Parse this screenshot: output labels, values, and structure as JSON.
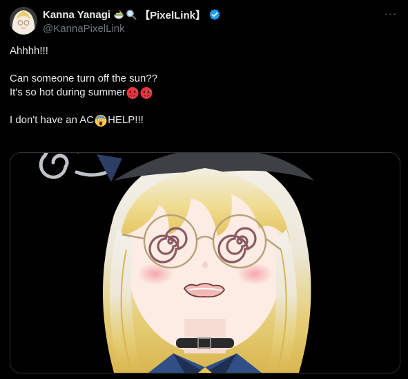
{
  "author": {
    "display_name": "Kanna Yanagi",
    "name_emoji": [
      "noodle-bowl-emoji",
      "magnifier-emoji"
    ],
    "affiliation": "【PixelLink】",
    "handle": "@KannaPixelLink",
    "verified": true,
    "verified_color": "#1d9bf0"
  },
  "menu": {
    "more_label": "···"
  },
  "post": {
    "line1": "Ahhhh!!!",
    "line2": "Can someone turn off the sun??",
    "line3": "It's so hot during summer",
    "line3_emoji": [
      "hot-face-emoji",
      "hot-face-emoji"
    ],
    "line4_before": "I don't have an AC",
    "line4_emoji": "screaming-face-emoji",
    "line4_after": " HELP!!!"
  },
  "media": {
    "type": "image",
    "subject": "dizzy-anime-girl-illustration"
  },
  "colors": {
    "background": "#000000",
    "text": "#e7e9ea",
    "secondary": "#71767b",
    "border": "#2f3336"
  }
}
